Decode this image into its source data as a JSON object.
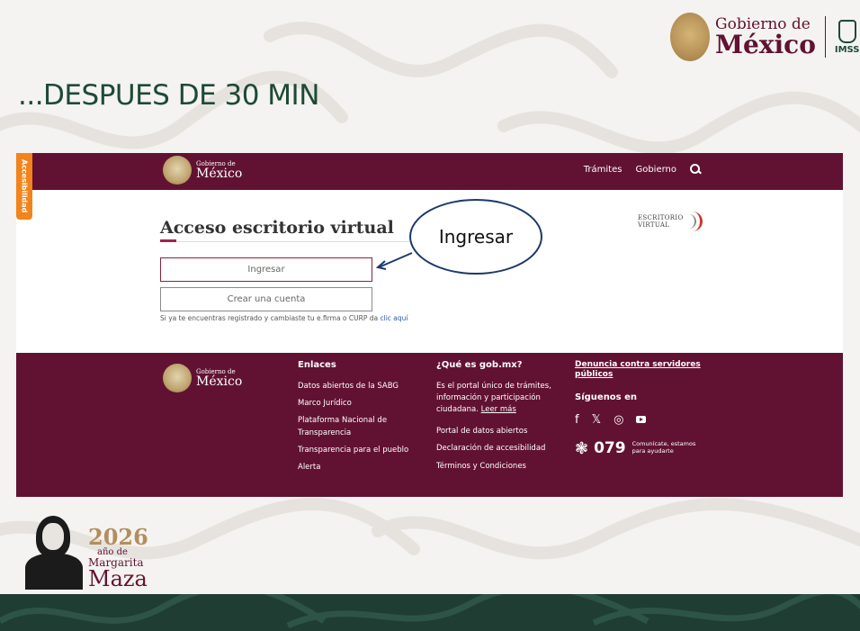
{
  "slide": {
    "title": "...DESPUES DE 30 MIN",
    "header_logo": {
      "line1": "Gobierno de",
      "line2": "México",
      "imss": "IMSS"
    }
  },
  "screenshot": {
    "accessibility_tab": "Accesibilidad",
    "nav": {
      "logo_line1": "Gobierno de",
      "logo_line2": "México",
      "links": [
        "Trámites",
        "Gobierno"
      ],
      "search_icon": "search-icon"
    },
    "main": {
      "heading": "Acceso escritorio virtual",
      "login_button": "Ingresar",
      "create_account_button": "Crear una cuenta",
      "hint_text": "Si ya te encuentras registrado y cambiaste tu e.firma o CURP da ",
      "hint_link": "clic aquí",
      "ev_logo_line1": "ESCRITORIO",
      "ev_logo_line2": "VIRTUAL"
    },
    "callout_label": "Ingresar",
    "footer": {
      "logo_line1": "Gobierno de",
      "logo_line2": "México",
      "enlaces_title": "Enlaces",
      "enlaces": [
        "Datos abiertos de la SABG",
        "Marco Jurídico",
        "Plataforma Nacional de Transparencia",
        "Transparencia para el pueblo",
        "Alerta"
      ],
      "que_es_title": "¿Qué es gob.mx?",
      "que_es_desc": "Es el portal único de trámites, información y participación ciudadana.",
      "leer_mas": "Leer más",
      "que_es_links": [
        "Portal de datos abiertos",
        "Declaración de accesibilidad",
        "Términos y Condiciones"
      ],
      "denuncia": "Denuncia contra servidores públicos",
      "siguenos": "Síguenos en",
      "social_icons": [
        "facebook-icon",
        "x-icon",
        "instagram-icon",
        "youtube-icon"
      ],
      "help_number": "079",
      "help_text_1": "Comunícate, estamos",
      "help_text_2": "para ayudarte"
    }
  },
  "bottom_logo": {
    "year": "2026",
    "line1": "año de",
    "line2": "Margarita",
    "line3": "Maza"
  },
  "colors": {
    "guinda": "#611232",
    "green_title": "#1e4a35",
    "gold": "#b38e5d",
    "accessibility_orange": "#f1841d"
  }
}
